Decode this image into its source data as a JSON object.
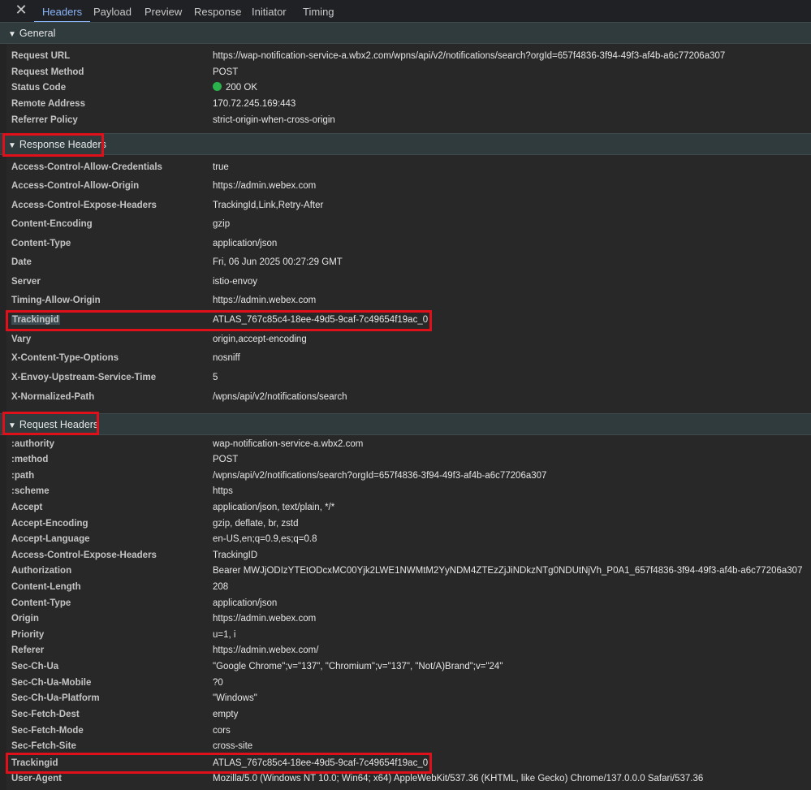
{
  "tabs": [
    {
      "label": "Headers",
      "active": true
    },
    {
      "label": "Payload",
      "active": false
    },
    {
      "label": "Preview",
      "active": false
    },
    {
      "label": "Response",
      "active": false
    },
    {
      "label": "Initiator",
      "active": false
    },
    {
      "label": "Timing",
      "active": false
    }
  ],
  "icons": {
    "close": "close-icon",
    "expand": "triangle-down-icon",
    "status": "status-dot-icon"
  },
  "colors": {
    "accent": "#8ab4f8",
    "status_ok": "#2bb24c",
    "highlight": "#e0101a"
  },
  "general": {
    "title": "General",
    "rows": [
      {
        "key": "Request URL",
        "value": "https://wap-notification-service-a.wbx2.com/wpns/api/v2/notifications/search?orgId=657f4836-3f94-49f3-af4b-a6c77206a307"
      },
      {
        "key": "Request Method",
        "value": "POST"
      },
      {
        "key": "Status Code",
        "value": "200 OK"
      },
      {
        "key": "Remote Address",
        "value": "170.72.245.169:443"
      },
      {
        "key": "Referrer Policy",
        "value": "strict-origin-when-cross-origin"
      }
    ]
  },
  "response_headers": {
    "title": "Response Headers",
    "rows": [
      {
        "key": "Access-Control-Allow-Credentials",
        "value": "true"
      },
      {
        "key": "Access-Control-Allow-Origin",
        "value": "https://admin.webex.com"
      },
      {
        "key": "Access-Control-Expose-Headers",
        "value": "TrackingId,Link,Retry-After"
      },
      {
        "key": "Content-Encoding",
        "value": "gzip"
      },
      {
        "key": "Content-Type",
        "value": "application/json"
      },
      {
        "key": "Date",
        "value": "Fri, 06 Jun 2025 00:27:29 GMT"
      },
      {
        "key": "Server",
        "value": "istio-envoy"
      },
      {
        "key": "Timing-Allow-Origin",
        "value": "https://admin.webex.com"
      },
      {
        "key": "Trackingid",
        "value": "ATLAS_767c85c4-18ee-49d5-9caf-7c49654f19ac_0"
      },
      {
        "key": "Vary",
        "value": "origin,accept-encoding"
      },
      {
        "key": "X-Content-Type-Options",
        "value": "nosniff"
      },
      {
        "key": "X-Envoy-Upstream-Service-Time",
        "value": "5"
      },
      {
        "key": "X-Normalized-Path",
        "value": "/wpns/api/v2/notifications/search"
      }
    ]
  },
  "request_headers": {
    "title": "Request Headers",
    "rows": [
      {
        "key": ":authority",
        "value": "wap-notification-service-a.wbx2.com"
      },
      {
        "key": ":method",
        "value": "POST"
      },
      {
        "key": ":path",
        "value": "/wpns/api/v2/notifications/search?orgId=657f4836-3f94-49f3-af4b-a6c77206a307"
      },
      {
        "key": ":scheme",
        "value": "https"
      },
      {
        "key": "Accept",
        "value": "application/json, text/plain, */*"
      },
      {
        "key": "Accept-Encoding",
        "value": "gzip, deflate, br, zstd"
      },
      {
        "key": "Accept-Language",
        "value": "en-US,en;q=0.9,es;q=0.8"
      },
      {
        "key": "Access-Control-Expose-Headers",
        "value": "TrackingID"
      },
      {
        "key": "Authorization",
        "value": "Bearer MWJjODIzYTEtODcxMC00Yjk2LWE1NWMtM2YyNDM4ZTEzZjJiNDkzNTg0NDUtNjVh_P0A1_657f4836-3f94-49f3-af4b-a6c77206a307"
      },
      {
        "key": "Content-Length",
        "value": "208"
      },
      {
        "key": "Content-Type",
        "value": "application/json"
      },
      {
        "key": "Origin",
        "value": "https://admin.webex.com"
      },
      {
        "key": "Priority",
        "value": "u=1, i"
      },
      {
        "key": "Referer",
        "value": "https://admin.webex.com/"
      },
      {
        "key": "Sec-Ch-Ua",
        "value": "\"Google Chrome\";v=\"137\", \"Chromium\";v=\"137\", \"Not/A)Brand\";v=\"24\""
      },
      {
        "key": "Sec-Ch-Ua-Mobile",
        "value": "?0"
      },
      {
        "key": "Sec-Ch-Ua-Platform",
        "value": "\"Windows\""
      },
      {
        "key": "Sec-Fetch-Dest",
        "value": "empty"
      },
      {
        "key": "Sec-Fetch-Mode",
        "value": "cors"
      },
      {
        "key": "Sec-Fetch-Site",
        "value": "cross-site"
      },
      {
        "key": "Trackingid",
        "value": "ATLAS_767c85c4-18ee-49d5-9caf-7c49654f19ac_0"
      },
      {
        "key": "User-Agent",
        "value": "Mozilla/5.0 (Windows NT 10.0; Win64; x64) AppleWebKit/537.36 (KHTML, like Gecko) Chrome/137.0.0.0 Safari/537.36"
      }
    ]
  }
}
